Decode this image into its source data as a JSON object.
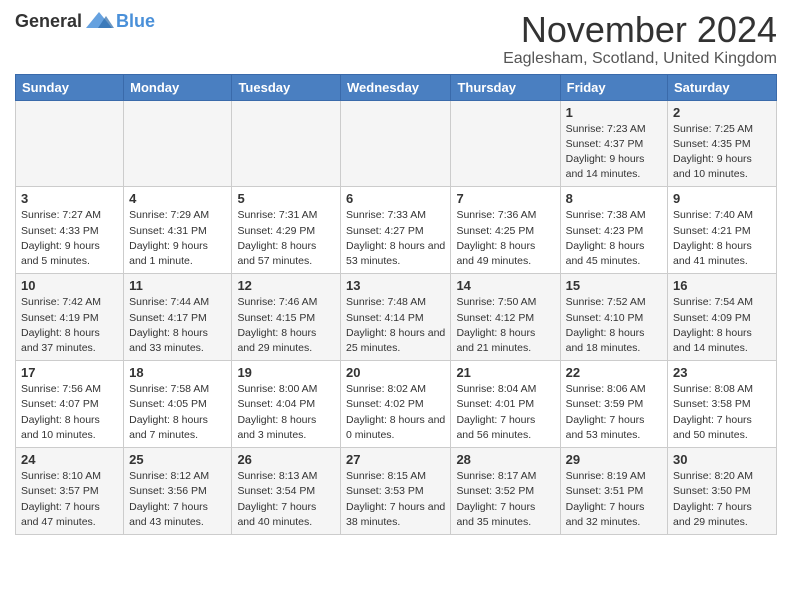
{
  "logo": {
    "general": "General",
    "blue": "Blue"
  },
  "title": "November 2024",
  "subtitle": "Eaglesham, Scotland, United Kingdom",
  "days_of_week": [
    "Sunday",
    "Monday",
    "Tuesday",
    "Wednesday",
    "Thursday",
    "Friday",
    "Saturday"
  ],
  "weeks": [
    [
      {
        "day": "",
        "info": ""
      },
      {
        "day": "",
        "info": ""
      },
      {
        "day": "",
        "info": ""
      },
      {
        "day": "",
        "info": ""
      },
      {
        "day": "",
        "info": ""
      },
      {
        "day": "1",
        "info": "Sunrise: 7:23 AM\nSunset: 4:37 PM\nDaylight: 9 hours and 14 minutes."
      },
      {
        "day": "2",
        "info": "Sunrise: 7:25 AM\nSunset: 4:35 PM\nDaylight: 9 hours and 10 minutes."
      }
    ],
    [
      {
        "day": "3",
        "info": "Sunrise: 7:27 AM\nSunset: 4:33 PM\nDaylight: 9 hours and 5 minutes."
      },
      {
        "day": "4",
        "info": "Sunrise: 7:29 AM\nSunset: 4:31 PM\nDaylight: 9 hours and 1 minute."
      },
      {
        "day": "5",
        "info": "Sunrise: 7:31 AM\nSunset: 4:29 PM\nDaylight: 8 hours and 57 minutes."
      },
      {
        "day": "6",
        "info": "Sunrise: 7:33 AM\nSunset: 4:27 PM\nDaylight: 8 hours and 53 minutes."
      },
      {
        "day": "7",
        "info": "Sunrise: 7:36 AM\nSunset: 4:25 PM\nDaylight: 8 hours and 49 minutes."
      },
      {
        "day": "8",
        "info": "Sunrise: 7:38 AM\nSunset: 4:23 PM\nDaylight: 8 hours and 45 minutes."
      },
      {
        "day": "9",
        "info": "Sunrise: 7:40 AM\nSunset: 4:21 PM\nDaylight: 8 hours and 41 minutes."
      }
    ],
    [
      {
        "day": "10",
        "info": "Sunrise: 7:42 AM\nSunset: 4:19 PM\nDaylight: 8 hours and 37 minutes."
      },
      {
        "day": "11",
        "info": "Sunrise: 7:44 AM\nSunset: 4:17 PM\nDaylight: 8 hours and 33 minutes."
      },
      {
        "day": "12",
        "info": "Sunrise: 7:46 AM\nSunset: 4:15 PM\nDaylight: 8 hours and 29 minutes."
      },
      {
        "day": "13",
        "info": "Sunrise: 7:48 AM\nSunset: 4:14 PM\nDaylight: 8 hours and 25 minutes."
      },
      {
        "day": "14",
        "info": "Sunrise: 7:50 AM\nSunset: 4:12 PM\nDaylight: 8 hours and 21 minutes."
      },
      {
        "day": "15",
        "info": "Sunrise: 7:52 AM\nSunset: 4:10 PM\nDaylight: 8 hours and 18 minutes."
      },
      {
        "day": "16",
        "info": "Sunrise: 7:54 AM\nSunset: 4:09 PM\nDaylight: 8 hours and 14 minutes."
      }
    ],
    [
      {
        "day": "17",
        "info": "Sunrise: 7:56 AM\nSunset: 4:07 PM\nDaylight: 8 hours and 10 minutes."
      },
      {
        "day": "18",
        "info": "Sunrise: 7:58 AM\nSunset: 4:05 PM\nDaylight: 8 hours and 7 minutes."
      },
      {
        "day": "19",
        "info": "Sunrise: 8:00 AM\nSunset: 4:04 PM\nDaylight: 8 hours and 3 minutes."
      },
      {
        "day": "20",
        "info": "Sunrise: 8:02 AM\nSunset: 4:02 PM\nDaylight: 8 hours and 0 minutes."
      },
      {
        "day": "21",
        "info": "Sunrise: 8:04 AM\nSunset: 4:01 PM\nDaylight: 7 hours and 56 minutes."
      },
      {
        "day": "22",
        "info": "Sunrise: 8:06 AM\nSunset: 3:59 PM\nDaylight: 7 hours and 53 minutes."
      },
      {
        "day": "23",
        "info": "Sunrise: 8:08 AM\nSunset: 3:58 PM\nDaylight: 7 hours and 50 minutes."
      }
    ],
    [
      {
        "day": "24",
        "info": "Sunrise: 8:10 AM\nSunset: 3:57 PM\nDaylight: 7 hours and 47 minutes."
      },
      {
        "day": "25",
        "info": "Sunrise: 8:12 AM\nSunset: 3:56 PM\nDaylight: 7 hours and 43 minutes."
      },
      {
        "day": "26",
        "info": "Sunrise: 8:13 AM\nSunset: 3:54 PM\nDaylight: 7 hours and 40 minutes."
      },
      {
        "day": "27",
        "info": "Sunrise: 8:15 AM\nSunset: 3:53 PM\nDaylight: 7 hours and 38 minutes."
      },
      {
        "day": "28",
        "info": "Sunrise: 8:17 AM\nSunset: 3:52 PM\nDaylight: 7 hours and 35 minutes."
      },
      {
        "day": "29",
        "info": "Sunrise: 8:19 AM\nSunset: 3:51 PM\nDaylight: 7 hours and 32 minutes."
      },
      {
        "day": "30",
        "info": "Sunrise: 8:20 AM\nSunset: 3:50 PM\nDaylight: 7 hours and 29 minutes."
      }
    ]
  ]
}
